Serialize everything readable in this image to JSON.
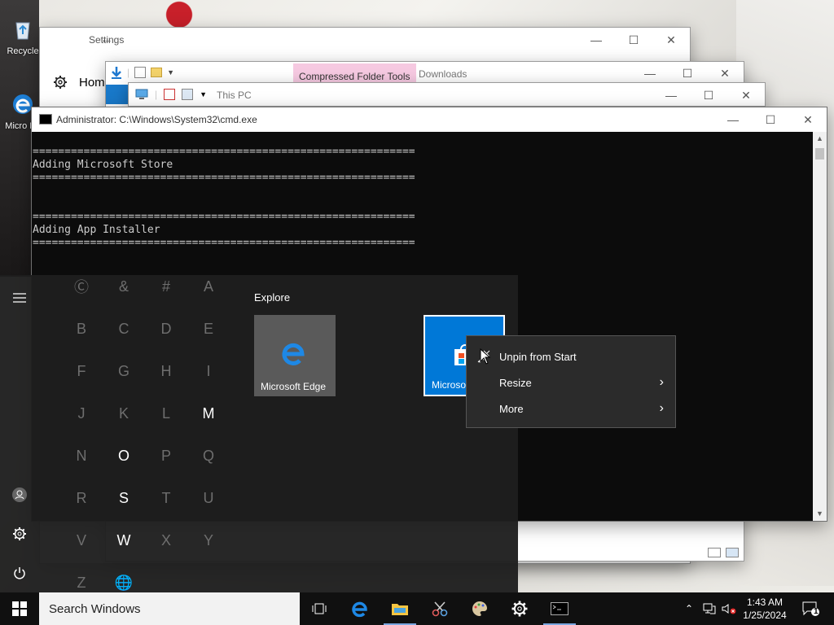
{
  "desktop": {
    "icons": [
      {
        "label": "Recycle",
        "icon": "recycle-bin-icon"
      },
      {
        "label": "Micro Ed",
        "icon": "edge-shortcut-icon"
      }
    ]
  },
  "settings": {
    "title": "Settings",
    "home_label": "Home"
  },
  "downloads": {
    "context_tab": "Compressed Folder Tools",
    "title": "Downloads"
  },
  "thispc": {
    "title": "This PC"
  },
  "cmd": {
    "title": "Administrator: C:\\Windows\\System32\\cmd.exe",
    "output": "============================================================\nAdding Microsoft Store\n============================================================\n\n\n============================================================\nAdding App Installer\n============================================================"
  },
  "start_menu": {
    "letters": [
      {
        "ch": "Ⓒ",
        "on": false
      },
      {
        "ch": "&",
        "on": false
      },
      {
        "ch": "#",
        "on": false
      },
      {
        "ch": "A",
        "on": false
      },
      {
        "ch": "B",
        "on": false
      },
      {
        "ch": "C",
        "on": false
      },
      {
        "ch": "D",
        "on": false
      },
      {
        "ch": "E",
        "on": false
      },
      {
        "ch": "F",
        "on": false
      },
      {
        "ch": "G",
        "on": false
      },
      {
        "ch": "H",
        "on": false
      },
      {
        "ch": "I",
        "on": false
      },
      {
        "ch": "J",
        "on": false
      },
      {
        "ch": "K",
        "on": false
      },
      {
        "ch": "L",
        "on": false
      },
      {
        "ch": "M",
        "on": true
      },
      {
        "ch": "N",
        "on": false
      },
      {
        "ch": "O",
        "on": true
      },
      {
        "ch": "P",
        "on": false
      },
      {
        "ch": "Q",
        "on": false
      },
      {
        "ch": "R",
        "on": false
      },
      {
        "ch": "S",
        "on": true
      },
      {
        "ch": "T",
        "on": false
      },
      {
        "ch": "U",
        "on": false
      },
      {
        "ch": "V",
        "on": false
      },
      {
        "ch": "W",
        "on": true
      },
      {
        "ch": "X",
        "on": false
      },
      {
        "ch": "Y",
        "on": false
      },
      {
        "ch": "Z",
        "on": false
      },
      {
        "ch": "🌐",
        "on": false
      }
    ],
    "group_label": "Explore",
    "tiles": [
      {
        "label": "Microsoft Edge"
      },
      {
        "label": "Microso"
      }
    ]
  },
  "context_menu": {
    "items": [
      {
        "label": "Unpin from Start",
        "submenu": false
      },
      {
        "label": "Resize",
        "submenu": true
      },
      {
        "label": "More",
        "submenu": true
      }
    ]
  },
  "taskbar": {
    "search_placeholder": "Search Windows",
    "time": "1:43 AM",
    "date": "1/25/2024",
    "notification_count": "1"
  }
}
